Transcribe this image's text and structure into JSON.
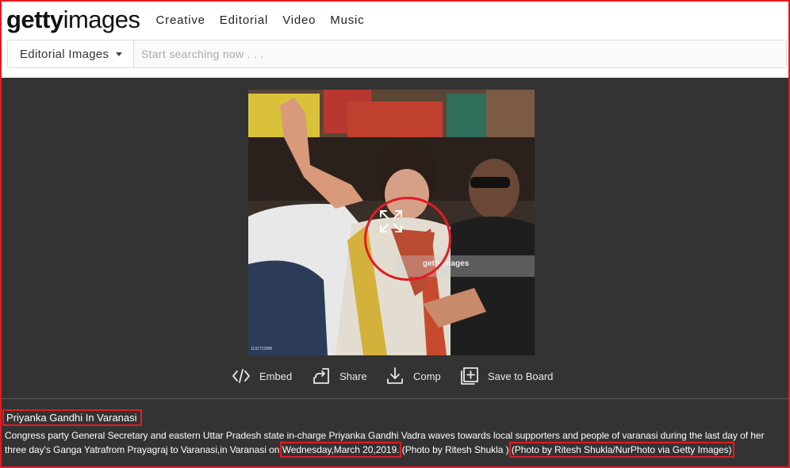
{
  "logo": {
    "bold": "getty",
    "light": "images"
  },
  "nav": [
    "Creative",
    "Editorial",
    "Video",
    "Music"
  ],
  "search": {
    "category": "Editorial Images",
    "placeholder": "Start searching now . . ."
  },
  "photo": {
    "watermark": "gettyimages",
    "id_label": "1131722886"
  },
  "actions": {
    "embed": "Embed",
    "share": "Share",
    "comp": "Comp",
    "save": "Save to Board"
  },
  "caption": {
    "title": "Priyanka Gandhi In Varanasi",
    "line1": "Congress party General Secretary and eastern Uttar Pradesh state in-charge Priyanka Gandhi Vadra waves towards local supporters and people of varanasi during the last day of her",
    "line2_a": "three day's Ganga Yatrafrom Prayagraj to Varanasi,in Varanasi on ",
    "date": "Wednesday,March 20,2019.",
    "line2_b": " (Photo by Ritesh Shukla ) ",
    "credit": "(Photo by Ritesh Shukla/NurPhoto via Getty Images)"
  },
  "colors": {
    "accent_red": "#e31b23",
    "dark_bg": "#333333"
  }
}
